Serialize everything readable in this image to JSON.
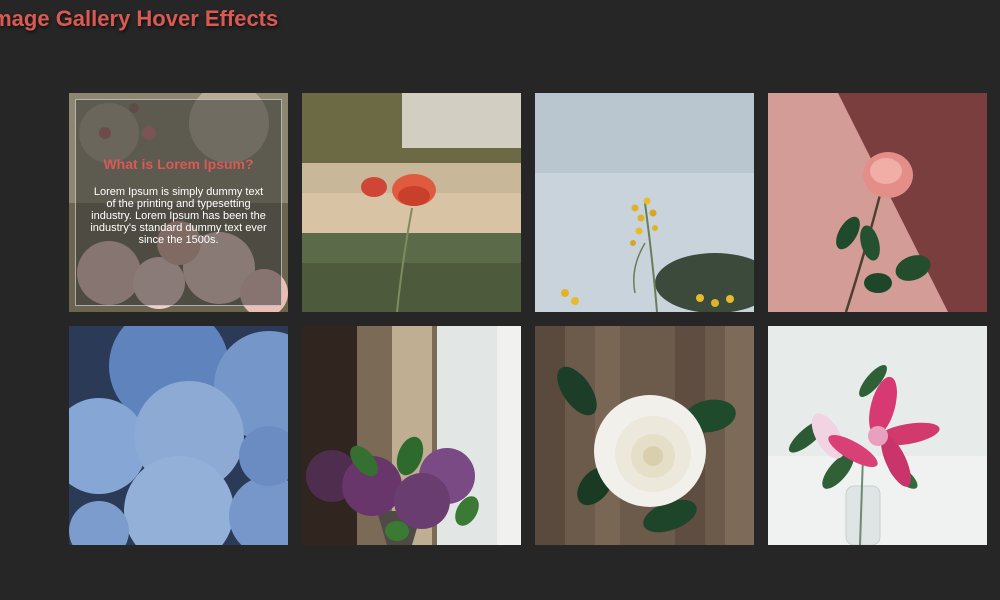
{
  "header": {
    "title": "Image Gallery Hover Effects"
  },
  "hover_card": {
    "heading": "What is Lorem Ipsum?",
    "body": "Lorem Ipsum is simply dummy text of the printing and typesetting industry. Lorem Ipsum has been the industry's standard dummy text ever since the 1500s."
  },
  "colors": {
    "background": "#262626",
    "accent": "#d85a53"
  },
  "gallery": [
    {
      "subject": "pink roses"
    },
    {
      "subject": "red poppy in field"
    },
    {
      "subject": "yellow wildflowers against sky"
    },
    {
      "subject": "pink rose on mauve wall"
    },
    {
      "subject": "blue hydrangeas"
    },
    {
      "subject": "purple lilac bouquet by window"
    },
    {
      "subject": "white rose on wood"
    },
    {
      "subject": "pink lily in glass vase"
    }
  ]
}
